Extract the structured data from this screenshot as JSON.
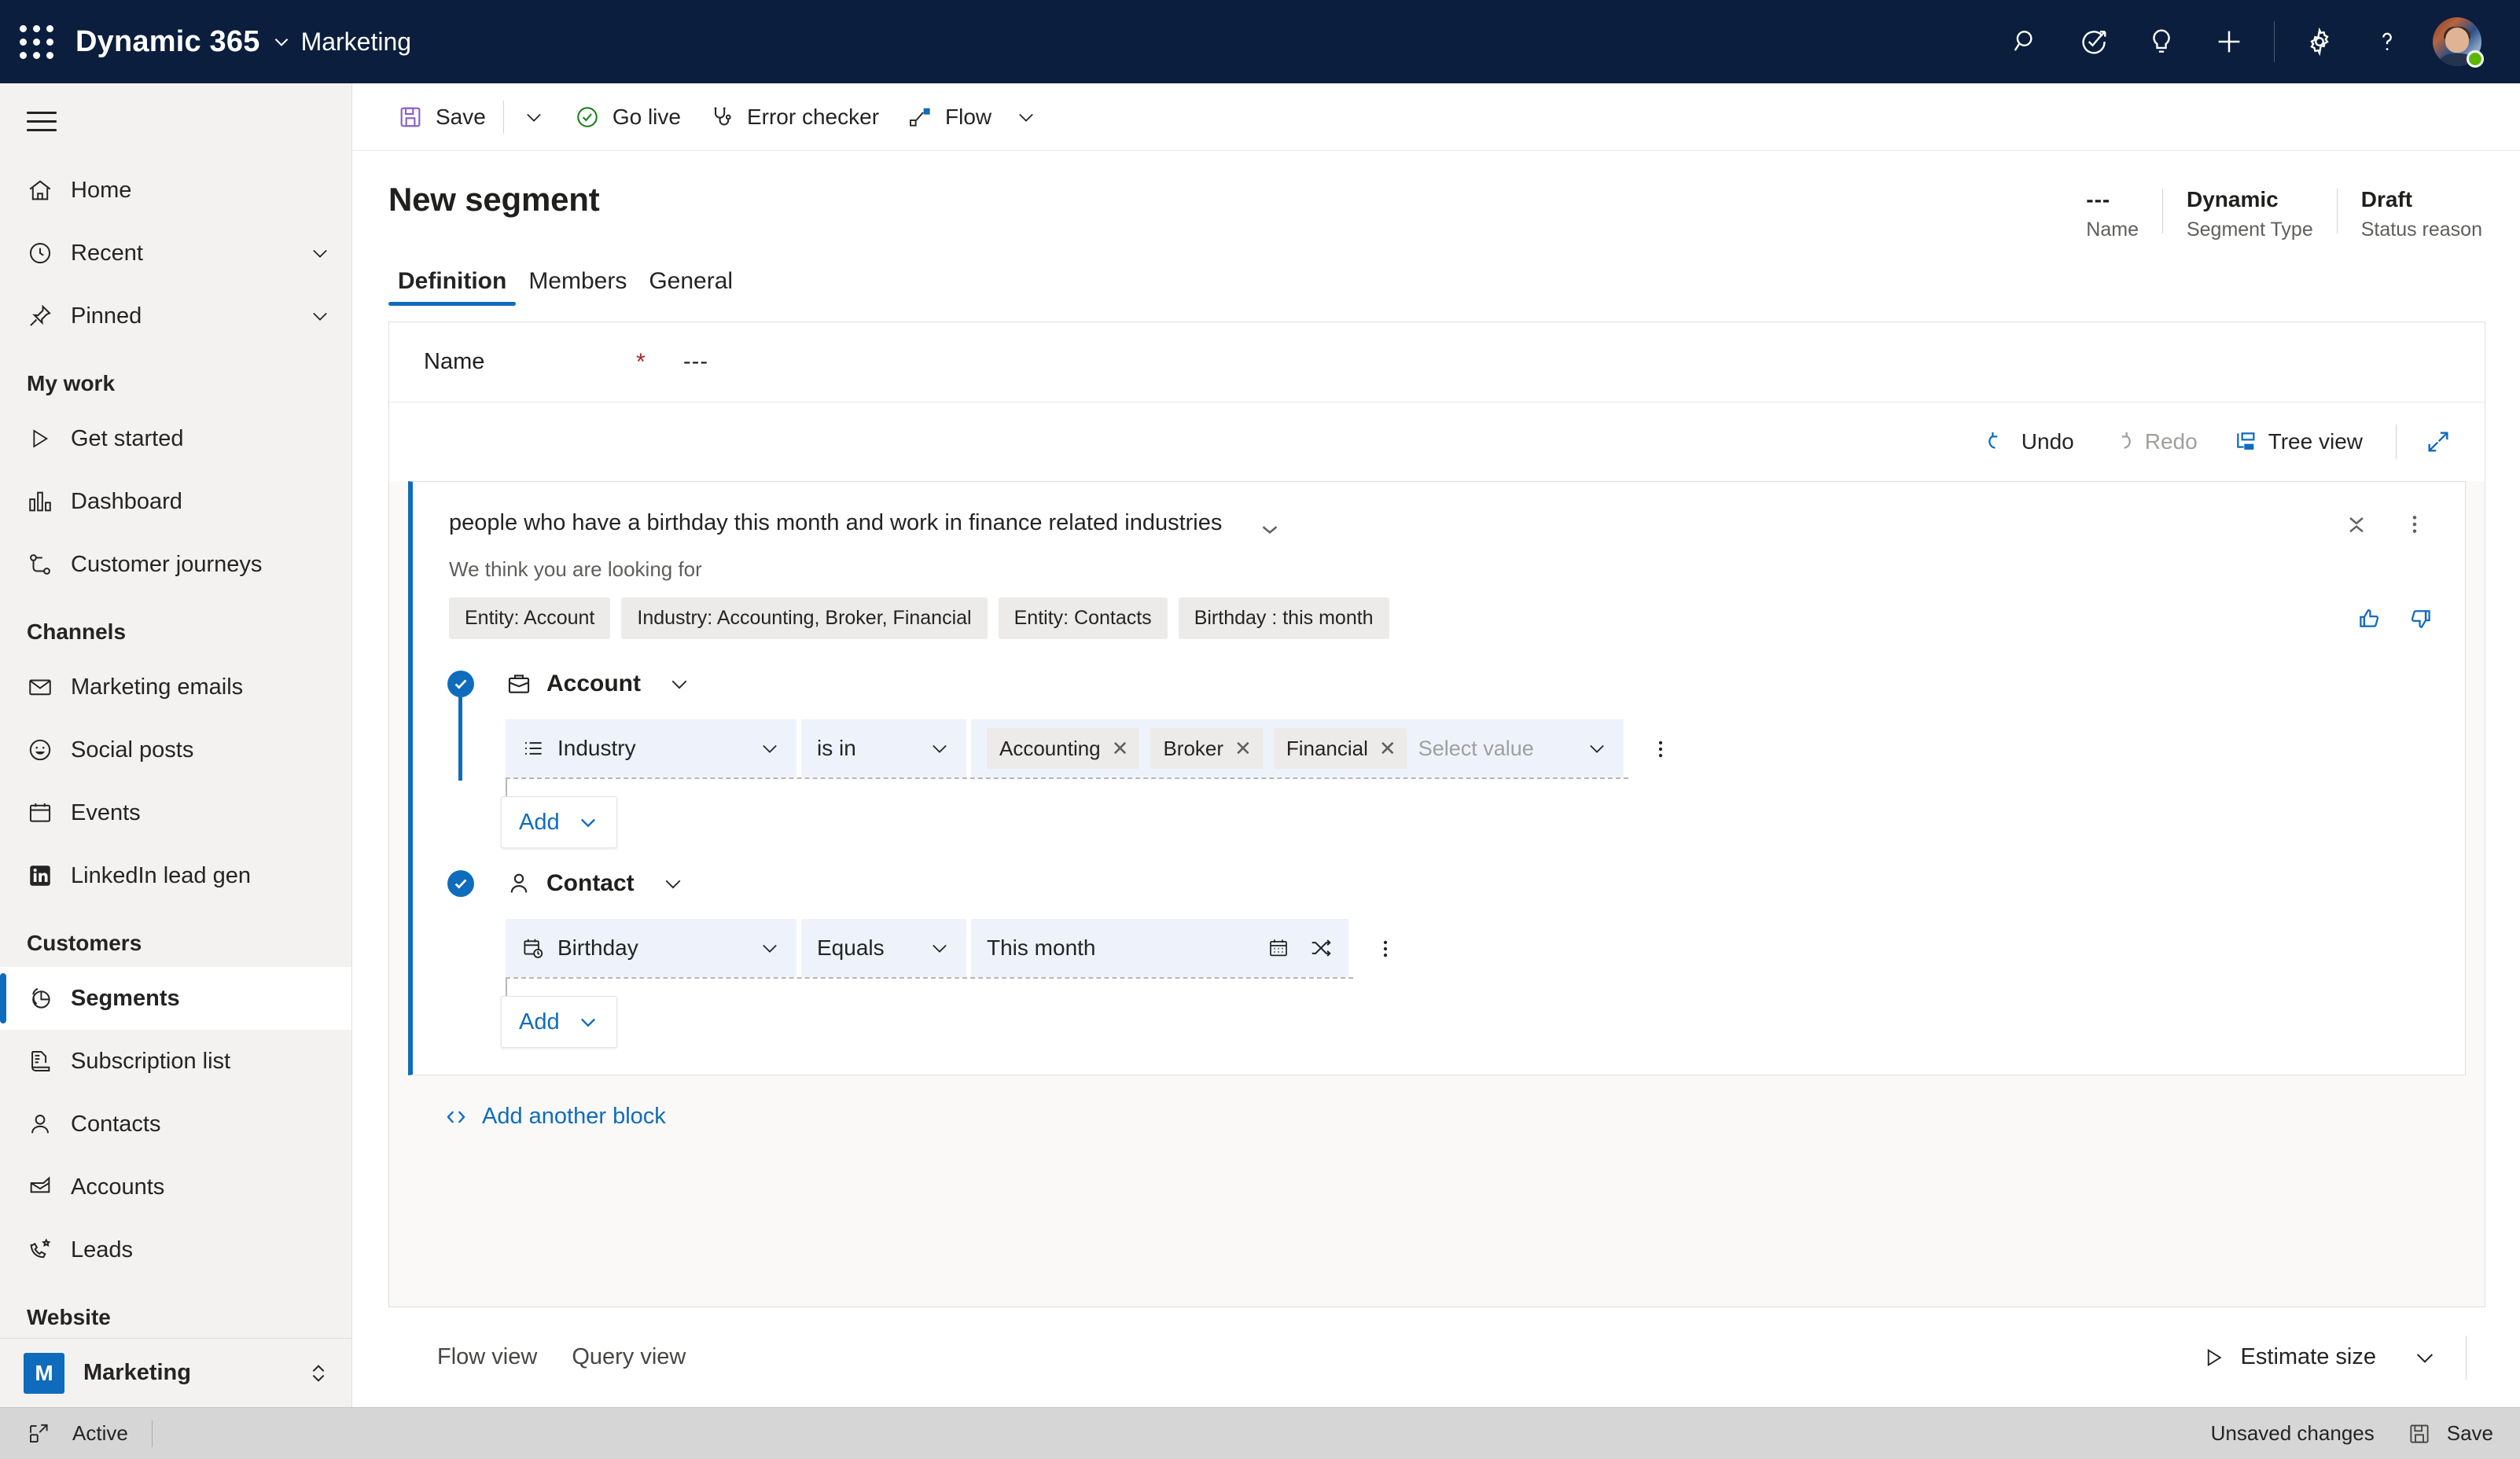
{
  "topbar": {
    "waffle_icon": "app-launcher-icon",
    "brand": "Dynamic 365",
    "brand_chevron": "chevron-down-icon",
    "app_name": "Marketing",
    "icons": [
      {
        "name": "search-icon",
        "label": "Search"
      },
      {
        "name": "diagnostics-icon",
        "label": "Diagnostics"
      },
      {
        "name": "lightbulb-icon",
        "label": "Ideas"
      },
      {
        "name": "add-icon",
        "label": "New"
      },
      {
        "name": "settings-gear-icon",
        "label": "Settings"
      },
      {
        "name": "help-question-icon",
        "label": "Help"
      }
    ],
    "avatar_presence": "available",
    "presence_color": "#5bb700"
  },
  "sidebar": {
    "hamburger_label": "Site map",
    "top_items": [
      {
        "label": "Home",
        "icon": "home-icon",
        "chevron": false
      },
      {
        "label": "Recent",
        "icon": "clock-icon",
        "chevron": true
      },
      {
        "label": "Pinned",
        "icon": "pin-icon",
        "chevron": true
      }
    ],
    "groups": [
      {
        "title": "My work",
        "items": [
          {
            "label": "Get started",
            "icon": "play-icon"
          },
          {
            "label": "Dashboard",
            "icon": "dashboard-icon"
          },
          {
            "label": "Customer journeys",
            "icon": "journey-icon"
          }
        ]
      },
      {
        "title": "Channels",
        "items": [
          {
            "label": "Marketing emails",
            "icon": "mail-icon"
          },
          {
            "label": "Social posts",
            "icon": "smiley-icon"
          },
          {
            "label": "Events",
            "icon": "calendar-icon"
          },
          {
            "label": "LinkedIn lead gen",
            "icon": "linkedin-icon"
          }
        ]
      },
      {
        "title": "Customers",
        "items": [
          {
            "label": "Segments",
            "icon": "segments-pie-icon",
            "active": true
          },
          {
            "label": "Subscription list",
            "icon": "subscription-icon"
          },
          {
            "label": "Contacts",
            "icon": "person-icon"
          },
          {
            "label": "Accounts",
            "icon": "account-icon"
          },
          {
            "label": "Leads",
            "icon": "leads-phone-icon"
          }
        ]
      },
      {
        "title": "Website",
        "items": []
      }
    ],
    "footer": {
      "badge": "M",
      "label": "Marketing",
      "icon": "up-down-chevron-icon"
    }
  },
  "commandbar": {
    "save": {
      "label": "Save",
      "icon": "save-floppy-icon",
      "color": "#8661c5"
    },
    "save_caret": "chevron-down-icon",
    "golive": {
      "label": "Go live",
      "icon": "check-circle-icon",
      "color": "#107c10"
    },
    "errorchecker": {
      "label": "Error checker",
      "icon": "stethoscope-icon"
    },
    "flow": {
      "label": "Flow",
      "icon": "flow-icon",
      "color": "#0f6cbd",
      "caret": "chevron-down-icon"
    }
  },
  "page": {
    "title": "New segment",
    "meta": [
      {
        "value": "---",
        "key": "Name"
      },
      {
        "value": "Dynamic",
        "key": "Segment Type"
      },
      {
        "value": "Draft",
        "key": "Status reason"
      }
    ],
    "tabs": [
      {
        "label": "Definition",
        "active": true
      },
      {
        "label": "Members",
        "active": false
      },
      {
        "label": "General",
        "active": false
      }
    ]
  },
  "form": {
    "name_label": "Name",
    "name_required": "*",
    "name_value": "---"
  },
  "editor_toolbar": {
    "undo": {
      "label": "Undo",
      "icon": "undo-icon",
      "enabled": true
    },
    "redo": {
      "label": "Redo",
      "icon": "redo-icon",
      "enabled": false
    },
    "treeview": {
      "label": "Tree view",
      "icon": "tree-view-icon"
    },
    "expand": {
      "icon": "expand-diagonal-icon"
    }
  },
  "suggestion": {
    "query_text": "people who have a birthday this month and work in finance related industries",
    "collapse_icon": "collapse-chevrons-icon",
    "more_icon": "more-vertical-icon",
    "subtitle": "We think you are looking for",
    "chips": [
      "Entity: Account",
      "Industry:  Accounting, Broker, Financial",
      "Entity: Contacts",
      "Birthday : this month"
    ],
    "feedback": [
      {
        "name": "thumbs-up-icon"
      },
      {
        "name": "thumbs-down-icon"
      }
    ]
  },
  "query": {
    "entities": [
      {
        "name": "Account",
        "icon": "briefcase-icon",
        "checked": true,
        "chevron": "chevron-down-icon",
        "condition": {
          "attribute": {
            "label": "Industry",
            "icon": "list-icon"
          },
          "operator": "is in",
          "value_tokens": [
            "Accounting",
            "Broker",
            "Financial"
          ],
          "value_placeholder": "Select value",
          "more_icon": "more-vertical-icon"
        },
        "add_button": {
          "label": "Add",
          "caret": "chevron-down-icon"
        }
      },
      {
        "name": "Contact",
        "icon": "person-icon",
        "checked": true,
        "chevron": "chevron-down-icon",
        "condition": {
          "attribute": {
            "label": "Birthday",
            "icon": "calendar-clock-icon"
          },
          "operator": "Equals",
          "value": "This month",
          "value_icons": [
            "calendar-icon",
            "shuffle-icon"
          ],
          "more_icon": "more-vertical-icon"
        },
        "add_button": {
          "label": "Add",
          "caret": "chevron-down-icon"
        }
      }
    ],
    "add_another_block": {
      "label": "Add another block",
      "icon": "code-brackets-icon"
    }
  },
  "bottom_panel": {
    "tabs": [
      {
        "label": "Flow view"
      },
      {
        "label": "Query view"
      }
    ],
    "estimate": {
      "label": "Estimate size",
      "icon": "play-triangle-icon"
    },
    "caret": "chevron-down-icon"
  },
  "statusbar": {
    "popout_icon": "open-in-new-window-icon",
    "state": "Active",
    "unsaved": "Unsaved changes",
    "save": {
      "label": "Save",
      "icon": "save-floppy-icon"
    }
  },
  "colors": {
    "header_bg": "#0b1e3d",
    "accent": "#0f6cbd",
    "field_bg": "#eef3fb",
    "chip_bg": "#edebe9",
    "canvas_bg": "#faf9f8",
    "statusbar_bg": "#d6d6d6"
  }
}
